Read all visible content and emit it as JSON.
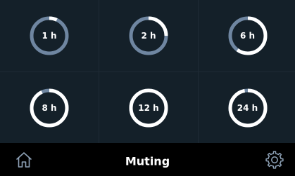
{
  "colors": {
    "track": "#6f86a1",
    "progress": "#ffffff",
    "tile_bg": "#142029",
    "bar_bg": "#000000"
  },
  "tiles": [
    {
      "label": "1 h",
      "fraction": 0.07
    },
    {
      "label": "2 h",
      "fraction": 0.25
    },
    {
      "label": "6 h",
      "fraction": 0.6
    },
    {
      "label": "8 h",
      "fraction": 0.93
    },
    {
      "label": "12 h",
      "fraction": 1.0
    },
    {
      "label": "24 h",
      "fraction": 0.97
    }
  ],
  "bottom_bar": {
    "title": "Muting",
    "left_icon": "home-icon",
    "right_icon": "gear-icon"
  }
}
